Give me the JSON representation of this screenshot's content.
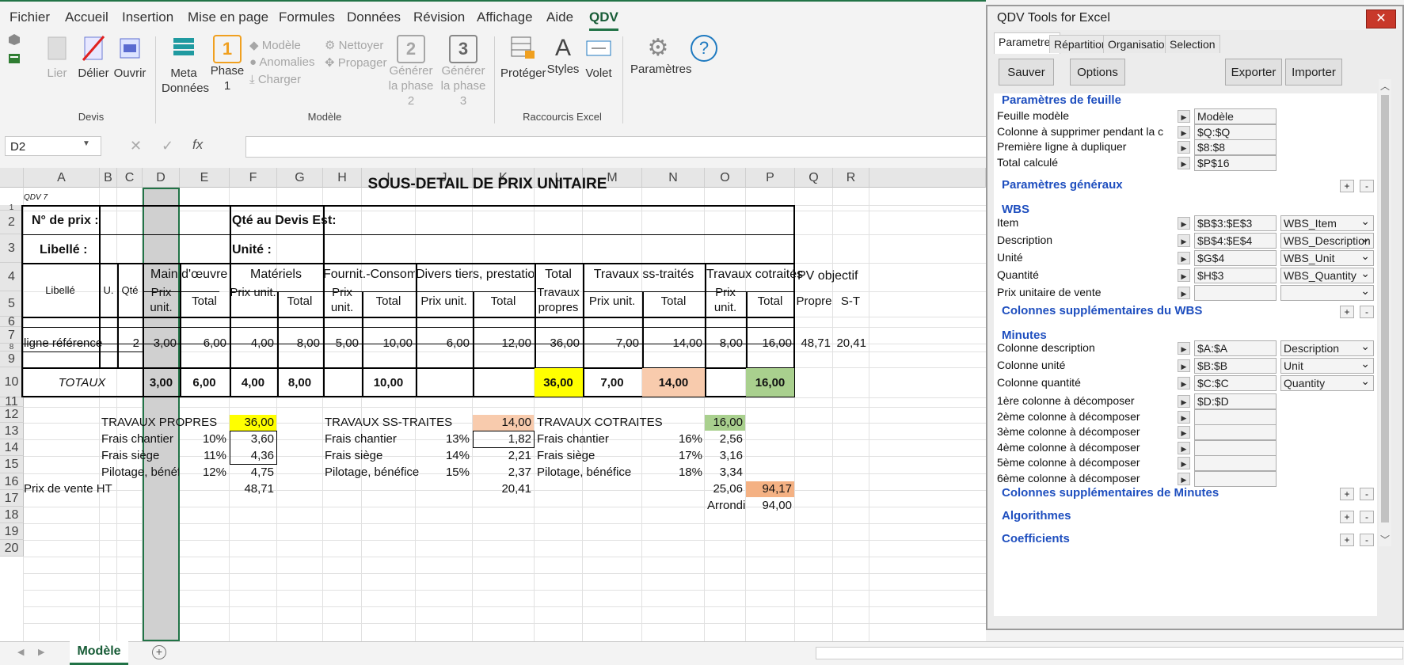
{
  "menu": {
    "tabs": [
      "Fichier",
      "Accueil",
      "Insertion",
      "Mise en page",
      "Formules",
      "Données",
      "Révision",
      "Affichage",
      "Aide",
      "QDV"
    ]
  },
  "ribbon": {
    "devis": {
      "label": "Devis",
      "buttons": [
        "Lier",
        "Délier",
        "Ouvrir"
      ]
    },
    "modele": {
      "label": "Modèle",
      "meta": "Meta Données",
      "phase1": "Phase 1",
      "phase1_num": "1",
      "modele": "Modèle",
      "anomalies": "Anomalies",
      "charger": "Charger",
      "nettoyer": "Nettoyer",
      "propager": "Propager",
      "gen2": "Générer la phase 2",
      "gen2_num": "2",
      "gen3": "Générer la phase 3",
      "gen3_num": "3"
    },
    "raccourcis": {
      "label": "Raccourcis Excel",
      "proteger": "Protéger",
      "styles": "Styles",
      "volet": "Volet"
    },
    "parametres": "Paramètres"
  },
  "formula": {
    "namebox": "D2",
    "fx": "fx"
  },
  "grid": {
    "cols": [
      "A",
      "B",
      "C",
      "D",
      "E",
      "F",
      "G",
      "H",
      "I",
      "J",
      "K",
      "L",
      "M",
      "N",
      "O",
      "P",
      "Q",
      "R"
    ],
    "rows": [
      "1",
      "2",
      "3",
      "4",
      "5",
      "6",
      "7",
      "8",
      "9",
      "10",
      "11",
      "12",
      "13",
      "14",
      "15",
      "16",
      "17",
      "18",
      "19",
      "20"
    ],
    "title": "SOUS-DETAIL DE PRIX UNITAIRE",
    "qdv": "QDV 7",
    "n_prix": "N° de prix :",
    "libelle_lbl": "Libellé :",
    "qte_devis": "Qté au Devis Est:",
    "unite_lbl": "Unité :",
    "h_libelle": "Libellé",
    "h_u": "U.",
    "h_qte": "Qté",
    "h_main": "Main d'œuvre",
    "h_mat": "Matériels",
    "h_fourn": "Fournit.-Consomm",
    "h_divers": "Divers tiers, prestations",
    "h_total": "Total",
    "h_travaux_propres": "Travaux propres",
    "h_ss": "Travaux ss-traités",
    "h_cot": "Travaux cotraités",
    "h_pv": "PV objectif",
    "h_pu": "Prix unit.",
    "h_tot": "Total",
    "h_pu2": "Prix unit.",
    "h_propre": "Propre",
    "h_st": "S-T",
    "row8": {
      "a": "ligne référence",
      "c": "2",
      "d": "3,00",
      "e": "6,00",
      "f": "4,00",
      "g": "8,00",
      "h": "5,00",
      "i": "10,00",
      "j": "6,00",
      "k": "12,00",
      "l": "36,00",
      "m": "7,00",
      "n": "14,00",
      "o": "8,00",
      "p": "16,00",
      "q": "48,71",
      "r": "20,41"
    },
    "row10": {
      "a": "TOTAUX",
      "d": "3,00",
      "e": "6,00",
      "f": "4,00",
      "g": "8,00",
      "i": "10,00",
      "l": "36,00",
      "m": "7,00",
      "n": "14,00",
      "p": "16,00"
    },
    "recap": {
      "tp": "TRAVAUX PROPRES",
      "tp_v": "36,00",
      "fc": "Frais chantier",
      "fc_p": "10%",
      "fc_v": "3,60",
      "fs": "Frais siège",
      "fs_p": "11%",
      "fs_v": "4,36",
      "pb": "Pilotage, bénéf",
      "pb_p": "12%",
      "pb_v": "4,75",
      "pv": "Prix de vente HT",
      "pv_v": "48,71",
      "st": "TRAVAUX SS-TRAITES",
      "st_v": "14,00",
      "st_fc": "Frais chantier",
      "st_fc_p": "13%",
      "st_fc_v": "1,82",
      "st_fs": "Frais siège",
      "st_fs_p": "14%",
      "st_fs_v": "2,21",
      "st_pb": "Pilotage, bénéfice",
      "st_pb_p": "15%",
      "st_pb_v": "2,37",
      "st_total": "20,41",
      "ct": "TRAVAUX COTRAITES",
      "ct_v": "16,00",
      "ct_fc": "Frais chantier",
      "ct_fc_p": "16%",
      "ct_fc_v": "2,56",
      "ct_fs": "Frais siège",
      "ct_fs_p": "17%",
      "ct_fs_v": "3,16",
      "ct_pb": "Pilotage, bénéfice",
      "ct_pb_p": "18%",
      "ct_pb_v": "3,34",
      "ct_total": "25,06",
      "grand": "94,17",
      "arrondi": "Arrondi",
      "arrondi_v": "94,00"
    }
  },
  "sheet": {
    "tab": "Modèle"
  },
  "panel": {
    "title": "QDV Tools for Excel",
    "close": "✕",
    "tabs": [
      "Parametres",
      "Répartition",
      "Organisation",
      "Selection"
    ],
    "buttons": {
      "save": "Sauver",
      "options": "Options",
      "export": "Exporter",
      "import": "Importer"
    },
    "sec_feuille": "Paramètres de feuille",
    "feuille": [
      {
        "label": "Feuille modèle",
        "value": "Modèle"
      },
      {
        "label": "Colonne à supprimer pendant la co",
        "value": "$Q:$Q"
      },
      {
        "label": "Première ligne à dupliquer",
        "value": "$8:$8"
      },
      {
        "label": "Total calculé",
        "value": "$P$16"
      }
    ],
    "sec_generaux": "Paramètres généraux",
    "sec_wbs": "WBS",
    "wbs": [
      {
        "label": "Item",
        "value": "$B$3:$E$3",
        "select": "WBS_Item"
      },
      {
        "label": "Description",
        "value": "$B$4:$E$4",
        "select": "WBS_Description"
      },
      {
        "label": "Unité",
        "value": "$G$4",
        "select": "WBS_Unit"
      },
      {
        "label": "Quantité",
        "value": "$H$3",
        "select": "WBS_Quantity"
      },
      {
        "label": "Prix unitaire de vente",
        "value": "",
        "select": ""
      }
    ],
    "sec_wbs_sup": "Colonnes supplémentaires du WBS",
    "sec_minutes": "Minutes",
    "minutes": [
      {
        "label": "Colonne description",
        "value": "$A:$A",
        "select": "Description"
      },
      {
        "label": "Colonne unité",
        "value": "$B:$B",
        "select": "Unit"
      },
      {
        "label": "Colonne quantité",
        "value": "$C:$C",
        "select": "Quantity"
      }
    ],
    "decomp": [
      {
        "label": "1ère colonne à décomposer",
        "value": "$D:$D"
      },
      {
        "label": "2ème colonne à décomposer",
        "value": ""
      },
      {
        "label": "3ème colonne à décomposer",
        "value": ""
      },
      {
        "label": "4ème colonne à décomposer",
        "value": ""
      },
      {
        "label": "5ème colonne à décomposer",
        "value": ""
      },
      {
        "label": "6ème colonne à décomposer",
        "value": ""
      }
    ],
    "sec_min_sup": "Colonnes supplémentaires de Minutes",
    "sec_algo": "Algorithmes",
    "sec_coef": "Coefficients",
    "plus": "+",
    "minus": "-"
  }
}
